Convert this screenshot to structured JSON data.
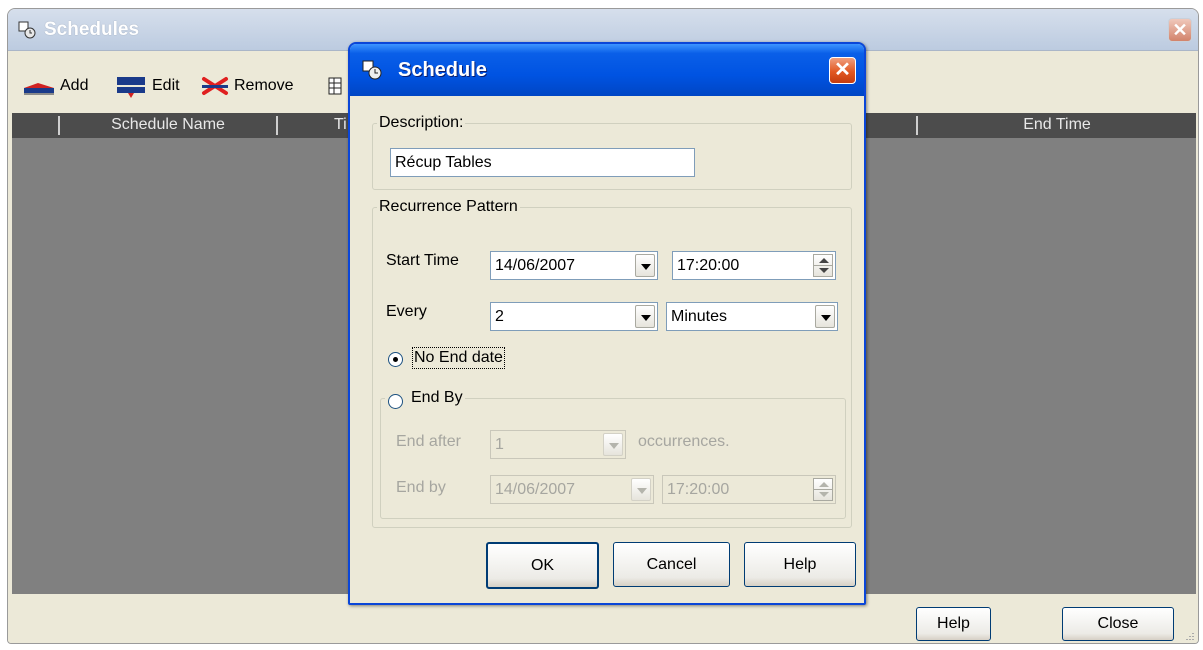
{
  "main_window": {
    "title": "Schedules",
    "toolbar": {
      "add_label": "Add",
      "edit_label": "Edit",
      "remove_label": "Remove"
    },
    "columns": {
      "schedule_name": "Schedule Name",
      "time_partial": "Ti",
      "end_time": "End Time"
    },
    "buttons": {
      "help": "Help",
      "close": "Close"
    }
  },
  "dialog": {
    "title": "Schedule",
    "description": {
      "legend": "Description:",
      "value": "Récup Tables"
    },
    "recurrence": {
      "legend": "Recurrence Pattern",
      "start_time_label": "Start Time",
      "start_date": "14/06/2007",
      "start_time": "17:20:00",
      "every_label": "Every",
      "every_value": "2",
      "every_unit": "Minutes",
      "no_end_label": "No End date",
      "no_end_selected": true,
      "end_by_legend": "End By",
      "end_after_label": "End after",
      "end_after_value": "1",
      "occurrences_label": "occurrences.",
      "end_by_label": "End by",
      "end_by_date": "14/06/2007",
      "end_by_time": "17:20:00"
    },
    "buttons": {
      "ok": "OK",
      "cancel": "Cancel",
      "help": "Help"
    }
  },
  "colors": {
    "dialog_title_blue": "#0053e2",
    "window_face": "#ece9d8",
    "grid_body": "#808080",
    "grid_header": "#4c4c4c"
  }
}
